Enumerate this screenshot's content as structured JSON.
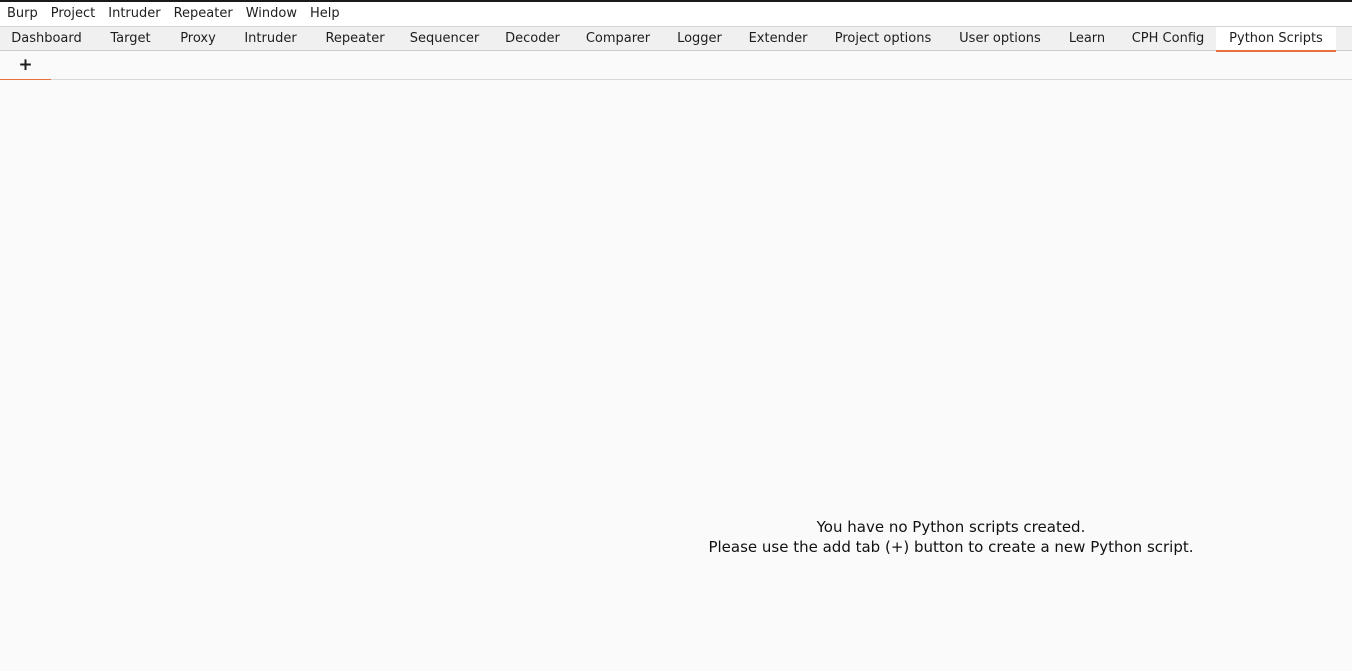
{
  "menubar": {
    "items": [
      "Burp",
      "Project",
      "Intruder",
      "Repeater",
      "Window",
      "Help"
    ]
  },
  "tabs": {
    "items": [
      "Dashboard",
      "Target",
      "Proxy",
      "Intruder",
      "Repeater",
      "Sequencer",
      "Decoder",
      "Comparer",
      "Logger",
      "Extender",
      "Project options",
      "User options",
      "Learn",
      "CPH Config",
      "Python Scripts"
    ],
    "active": "Python Scripts"
  },
  "subtabs": {
    "add_label": "+"
  },
  "empty_state": {
    "line1": "You have no Python scripts created.",
    "line2": "Please use the add tab (+) button to create a new Python script."
  },
  "colors": {
    "accent": "#e8703a",
    "background": "#fafafa"
  }
}
